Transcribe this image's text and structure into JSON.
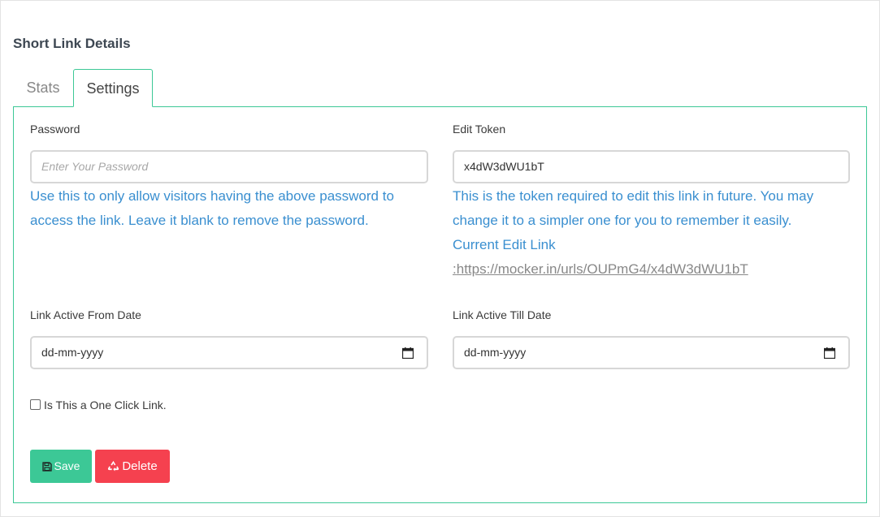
{
  "page": {
    "title": "Short Link Details"
  },
  "tabs": [
    {
      "label": "Stats",
      "active": false
    },
    {
      "label": "Settings",
      "active": true
    }
  ],
  "password": {
    "label": "Password",
    "placeholder": "Enter Your Password",
    "value": "",
    "help": "Use this to only allow visitors having the above password to access the link. Leave it blank to remove the password."
  },
  "edit_token": {
    "label": "Edit Token",
    "value": "x4dW3dWU1bT",
    "help": "This is the token required to edit this link in future. You may change it to a simpler one for you to remember it easily.",
    "current_link_label": "Current Edit Link",
    "current_link_prefix": ":",
    "current_link_url": "https://mocker.in/urls/OUPmG4/x4dW3dWU1bT"
  },
  "active_from": {
    "label": "Link Active From Date",
    "placeholder": "dd-mm-yyyy"
  },
  "active_till": {
    "label": "Link Active Till Date",
    "placeholder": "dd-mm-yyyy"
  },
  "one_click": {
    "label": "Is This a One Click Link.",
    "checked": false
  },
  "actions": {
    "save_label": "Save",
    "delete_label": "Delete"
  },
  "colors": {
    "accent": "#3cc896",
    "danger": "#f5414f",
    "help_text": "#3a8fd0"
  },
  "icons": {
    "save": "floppy-disk-icon",
    "delete": "recycle-icon",
    "date": "calendar-icon"
  }
}
